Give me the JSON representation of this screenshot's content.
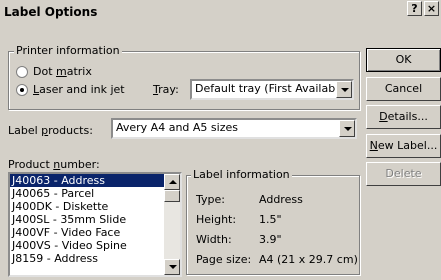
{
  "window": {
    "title": "Label Options",
    "help_label": "?",
    "close_label": "×"
  },
  "printer_info": {
    "legend": "Printer information",
    "options": [
      {
        "label_pre": "Dot ",
        "label_u": "m",
        "label_post": "atrix",
        "selected": false
      },
      {
        "label_pre": "",
        "label_u": "L",
        "label_post": "aser and ink jet",
        "selected": true
      }
    ],
    "tray_label_u": "T",
    "tray_label_rest": "ray:",
    "tray_value": "Default tray (First Available Tra"
  },
  "label_products": {
    "label_pre": "Label ",
    "label_u": "p",
    "label_post": "roducts:",
    "value": "Avery A4 and A5 sizes"
  },
  "product_number": {
    "label_pre": "Product ",
    "label_u": "n",
    "label_post": "umber:",
    "items": [
      "J40063 - Address",
      "J40065 - Parcel",
      "J400DK - Diskette",
      "J400SL - 35mm Slide",
      "J400VF - Video Face",
      "J400VS - Video Spine",
      "J8159 - Address"
    ],
    "selected_index": 0
  },
  "label_information": {
    "legend": "Label information",
    "rows": [
      {
        "key": "Type:",
        "value": "Address"
      },
      {
        "key": "Height:",
        "value": "1.5\""
      },
      {
        "key": "Width:",
        "value": "3.9\""
      },
      {
        "key": "Page size:",
        "value": "A4 (21 x 29.7 cm)"
      }
    ]
  },
  "buttons": {
    "ok": "OK",
    "cancel": "Cancel",
    "details_u": "D",
    "details_rest": "etails...",
    "new_label_u": "N",
    "new_label_rest": "ew Label...",
    "delete": "Delete"
  }
}
